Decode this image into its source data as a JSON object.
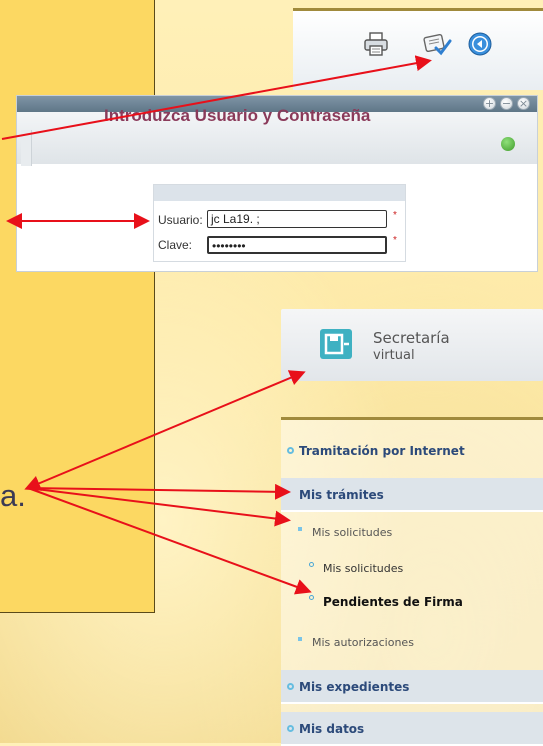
{
  "note": {
    "text": "a."
  },
  "toolbar": {
    "icons": [
      "printer-icon",
      "sign-document-icon",
      "back-arrow-icon"
    ]
  },
  "login": {
    "title": "Introduzca Usuario y Contraseña",
    "usuario_label": "Usuario:",
    "usuario_value": "jc  La19. ;",
    "clave_label": "Clave:",
    "clave_value": "••••••••",
    "required_marker": "*"
  },
  "secretaria": {
    "title": "Secretaría",
    "subtitle": "virtual"
  },
  "menu": {
    "items": [
      {
        "label": "Tramitación por Internet"
      },
      {
        "label": "Mis trámites"
      },
      {
        "label": "Mis solicitudes"
      },
      {
        "label": "Mis solicitudes"
      },
      {
        "label": "Pendientes de Firma"
      },
      {
        "label": "Mis autorizaciones"
      },
      {
        "label": "Mis expedientes"
      },
      {
        "label": "Mis datos"
      }
    ]
  },
  "colors": {
    "note_background": "#fcd862",
    "arrow": "#e8101a",
    "title": "#8a3a5a",
    "menu_section": "#dde4ea",
    "accent": "#66bde0"
  }
}
